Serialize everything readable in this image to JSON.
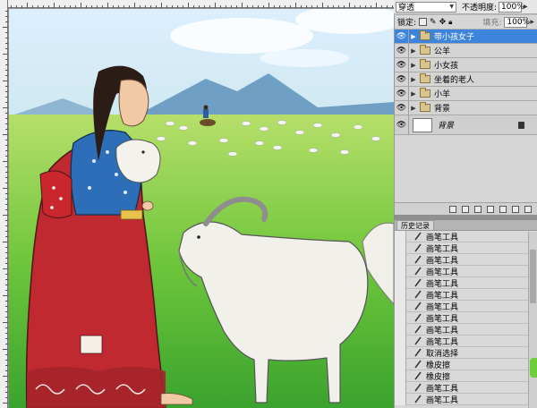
{
  "options_bar": {
    "blend_mode": "穿透",
    "opacity_label": "不透明度:",
    "opacity_value": "100%"
  },
  "lock_row": {
    "lock_label": "锁定:",
    "fill_label": "填充:",
    "fill_value": "100%"
  },
  "layers": [
    {
      "name": "带小孩女子",
      "selected": true
    },
    {
      "name": "公羊",
      "selected": false
    },
    {
      "name": "小女孩",
      "selected": false
    },
    {
      "name": "坐着的老人",
      "selected": false
    },
    {
      "name": "小羊",
      "selected": false
    },
    {
      "name": "背景",
      "selected": false
    }
  ],
  "background_layer": {
    "name": "背景"
  },
  "history": {
    "tab_label": "历史记录",
    "items": [
      "画笔工具",
      "画笔工具",
      "画笔工具",
      "画笔工具",
      "画笔工具",
      "画笔工具",
      "画笔工具",
      "画笔工具",
      "画笔工具",
      "画笔工具",
      "取消选择",
      "橡皮擦",
      "橡皮擦",
      "画笔工具",
      "画笔工具"
    ]
  },
  "colors": {
    "selection": "#3d85dc",
    "sky": "#cfe6f5",
    "grass": "#78c93d",
    "robe_red": "#c0292f",
    "robe_blue": "#2c6fb8"
  },
  "icons": {
    "visibility": "eye-icon",
    "group": "folder-icon",
    "history_brush": "brush-icon"
  }
}
